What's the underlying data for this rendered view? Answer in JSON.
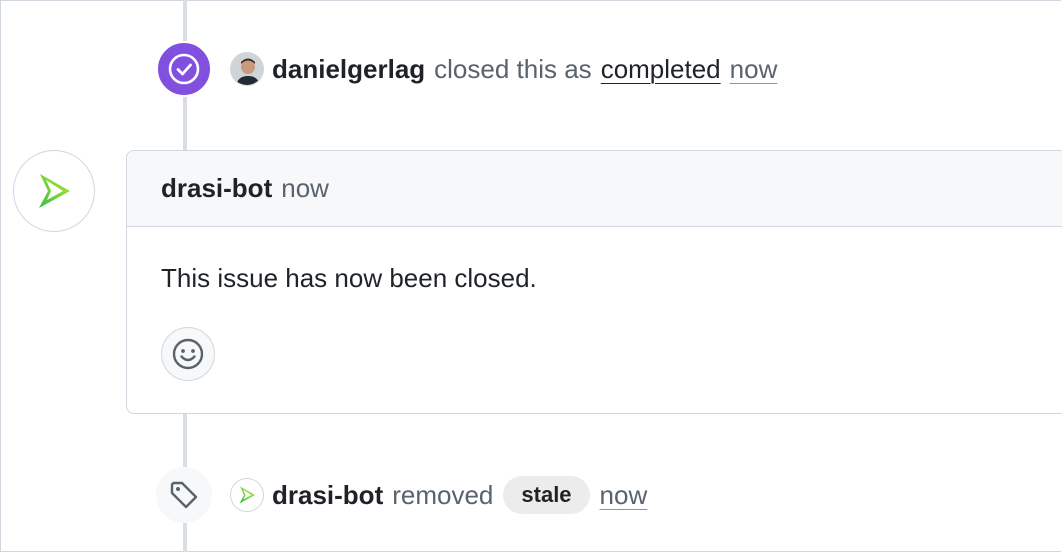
{
  "closed_event": {
    "actor": "danielgerlag",
    "action_text": "closed this as",
    "state": "completed",
    "time": "now"
  },
  "comment": {
    "author": "drasi-bot",
    "time": "now",
    "body": "This issue has now been closed."
  },
  "label_event": {
    "actor": "drasi-bot",
    "action_text": "removed",
    "label": "stale",
    "time": "now"
  },
  "colors": {
    "closed_badge": "#8250df",
    "label_pill": "#ececec",
    "timeline": "#d8dee4"
  }
}
